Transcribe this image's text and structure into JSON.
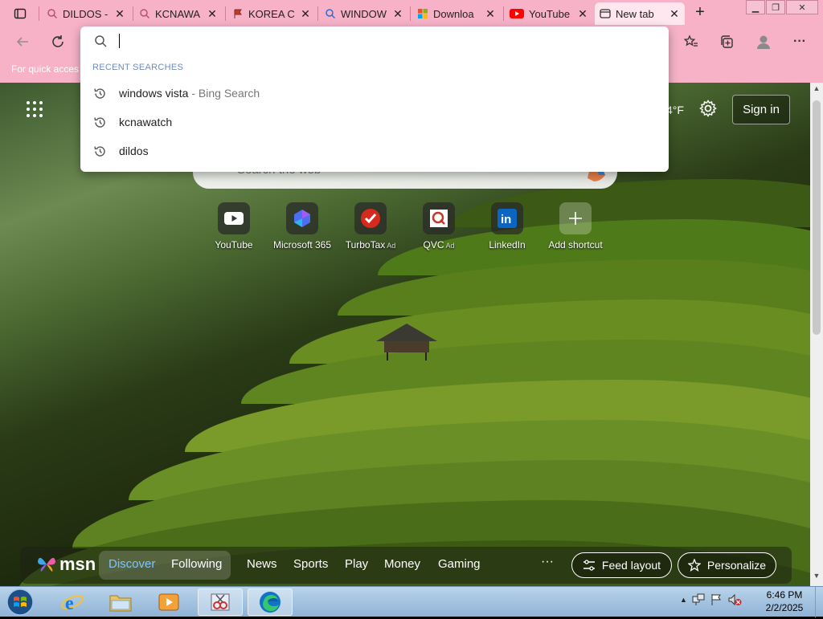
{
  "tabs": [
    {
      "title": "DILDOS -",
      "icon": "search-icon",
      "icon_color": "#b5527a"
    },
    {
      "title": "KCNAWA",
      "icon": "search-icon",
      "icon_color": "#b5527a"
    },
    {
      "title": "KOREA C",
      "icon": "kcna-flag-icon",
      "icon_color": "#c0392b"
    },
    {
      "title": "WINDOW",
      "icon": "search-icon",
      "icon_color": "#2b6ed1"
    },
    {
      "title": "Downloa",
      "icon": "microsoft-logo-icon",
      "icon_color": "#f25022"
    },
    {
      "title": "YouTube",
      "icon": "youtube-icon",
      "icon_color": "#ff0000"
    },
    {
      "title": "New tab",
      "icon": "new-tab-page-icon",
      "icon_color": "#333333",
      "active": true
    }
  ],
  "omnibox": {
    "value": "",
    "recent_header": "RECENT SEARCHES",
    "suggestions": [
      {
        "text": "windows vista",
        "sub": "- Bing Search"
      },
      {
        "text": "kcnawatch",
        "sub": ""
      },
      {
        "text": "dildos",
        "sub": ""
      }
    ]
  },
  "favbar": {
    "text": "For quick acces"
  },
  "page": {
    "weather_text": "4°F",
    "signin_label": "Sign in",
    "search_placeholder": "Search the web"
  },
  "shortcuts": [
    {
      "label": "YouTube",
      "ad": "",
      "icon": "youtube-icon"
    },
    {
      "label": "Microsoft 365",
      "ad": "",
      "icon": "microsoft-365-icon"
    },
    {
      "label": "TurboTax",
      "ad": "Ad",
      "icon": "turbotax-icon"
    },
    {
      "label": "QVC",
      "ad": "Ad",
      "icon": "qvc-icon"
    },
    {
      "label": "LinkedIn",
      "ad": "",
      "icon": "linkedin-icon"
    },
    {
      "label": "Add shortcut",
      "ad": "",
      "icon": "plus-icon"
    }
  ],
  "msn": {
    "logo_text": "msn",
    "tab_discover": "Discover",
    "tab_following": "Following",
    "nav": [
      "News",
      "Sports",
      "Play",
      "Money",
      "Gaming"
    ],
    "more": "···",
    "feed_layout": "Feed layout",
    "personalize": "Personalize"
  },
  "taskbar": {
    "time": "6:46 PM",
    "date": "2/2/2025"
  },
  "colors": {
    "chrome_pink": "#f7b2c8",
    "discover_blue": "#7ec3ff"
  }
}
